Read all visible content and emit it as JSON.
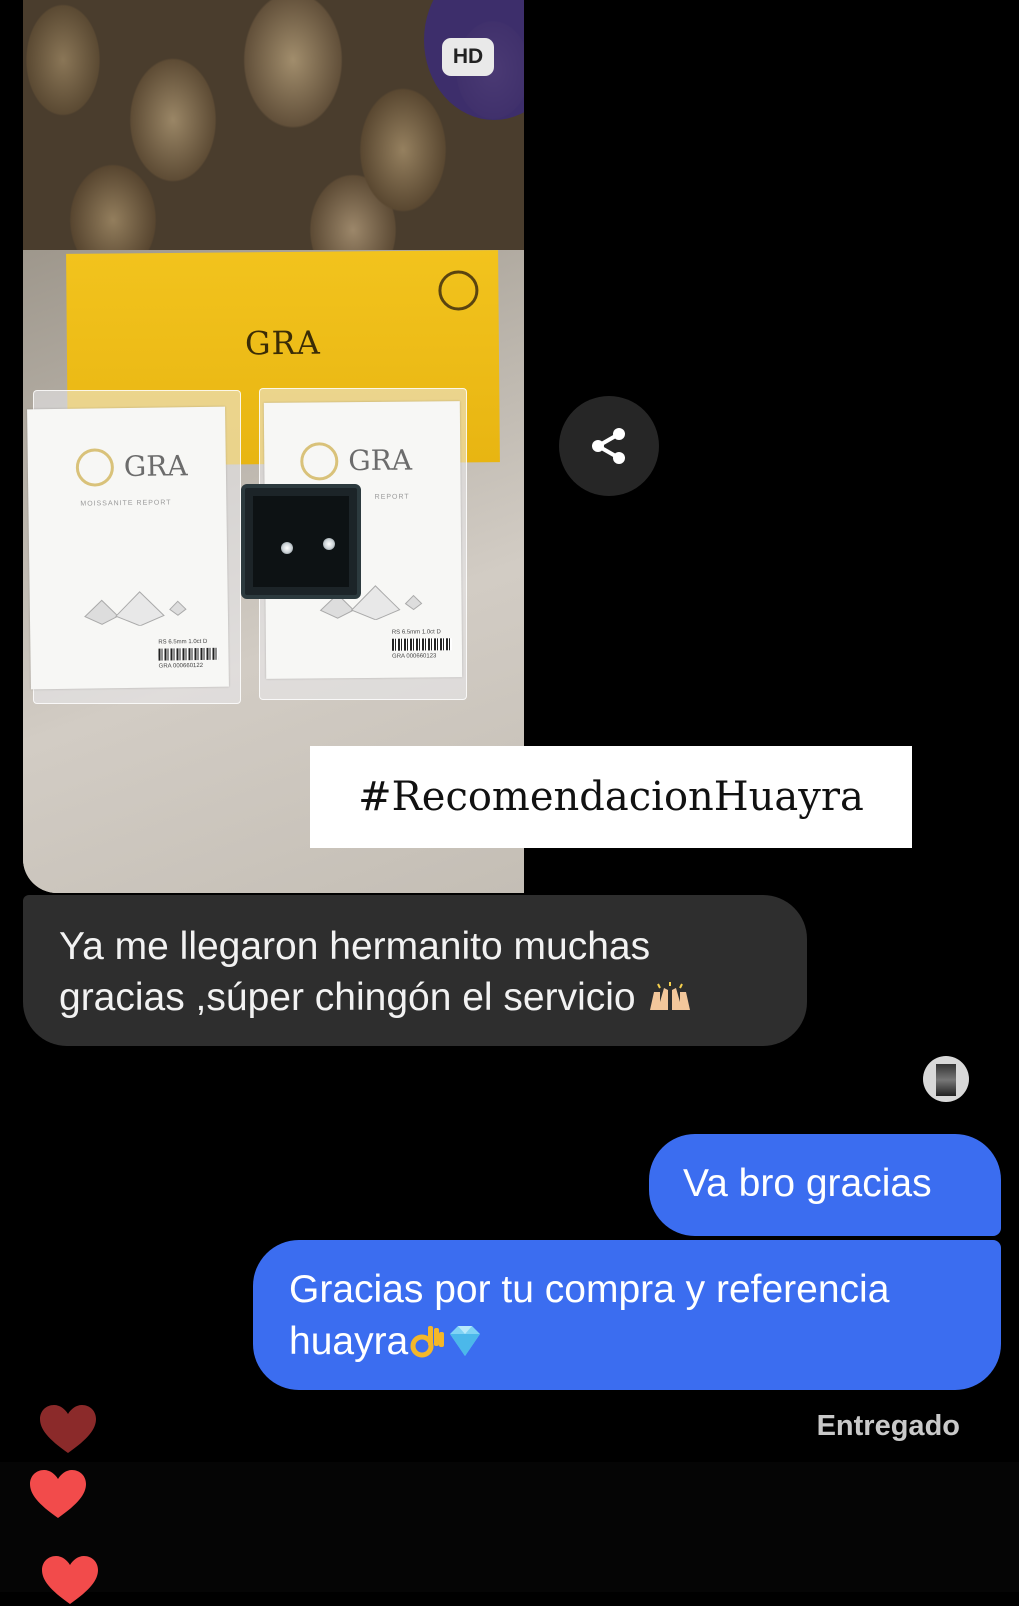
{
  "photo_message": {
    "hd_badge": "HD",
    "envelope_brand": "GRA",
    "certificates": [
      {
        "brand": "GRA",
        "subtitle": "MOISSANITE REPORT",
        "stock": "RS 6.5mm 1.0ct D",
        "number": "GRA 000660122"
      },
      {
        "brand": "GRA",
        "subtitle": "REPORT",
        "stock": "RS 6.5mm 1.0ct D",
        "number": "GRA 000660123"
      }
    ],
    "hashtag": "#RecomendacionHuayra"
  },
  "share_button": {
    "icon": "share-icon"
  },
  "messages": [
    {
      "direction": "incoming",
      "text_line1": "Ya me llegaron hermanito muchas",
      "text_line2": "gracias ,súper chingón el servicio",
      "emoji": "raised-hands"
    },
    {
      "direction": "outgoing",
      "text": "Va bro gracias"
    },
    {
      "direction": "outgoing",
      "text_line1": "Gracias por tu compra y referencia",
      "text_line2": "huayra",
      "emoji": [
        "ok-hand",
        "gem-stone"
      ]
    }
  ],
  "status": {
    "delivered": "Entregado"
  },
  "colors": {
    "incoming_bubble": "#2e2e2e",
    "outgoing_bubble": "#3b6df0",
    "background": "#000000",
    "heart_dark": "#8b2a2a",
    "heart_light": "#f24b4b"
  },
  "reactions": [
    "heart-icon",
    "heart-icon",
    "heart-icon"
  ]
}
